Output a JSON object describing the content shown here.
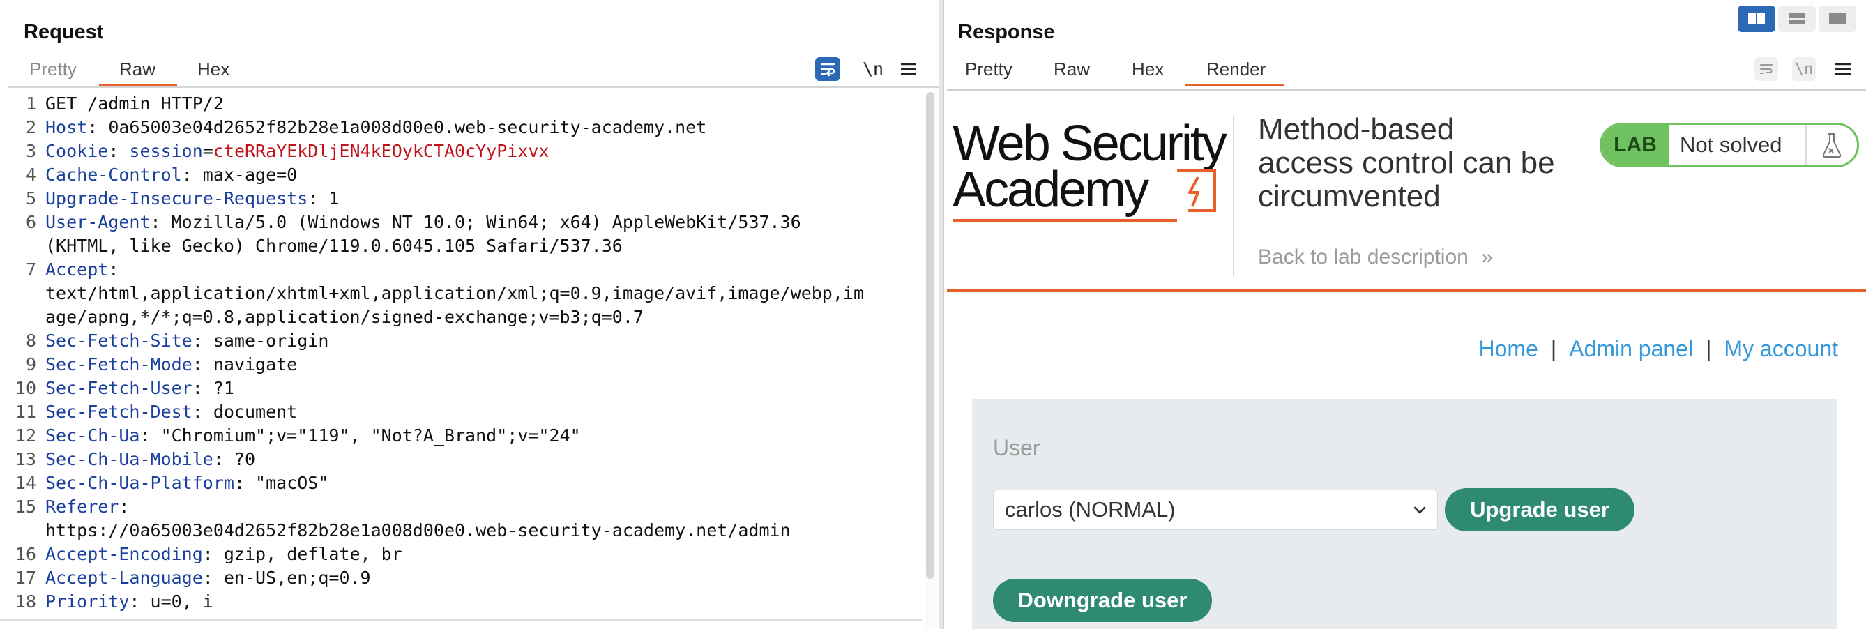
{
  "request": {
    "title": "Request",
    "tabs": [
      "Pretty",
      "Raw",
      "Hex"
    ],
    "active_tab": "Raw",
    "newline_toggle": "\\n",
    "lines": [
      {
        "n": "1",
        "parts": [
          {
            "t": "GET /admin HTTP/2",
            "c": "val"
          }
        ]
      },
      {
        "n": "2",
        "parts": [
          {
            "t": "Host",
            "c": "hdr"
          },
          {
            "t": ": 0a65003e04d2652f82b28e1a008d00e0.web-security-academy.net",
            "c": "val"
          }
        ]
      },
      {
        "n": "3",
        "parts": [
          {
            "t": "Cookie",
            "c": "hdr"
          },
          {
            "t": ": ",
            "c": "val"
          },
          {
            "t": "session",
            "c": "cookie-name"
          },
          {
            "t": "=",
            "c": "val"
          },
          {
            "t": "cteRRaYEkDljEN4kEOykCTA0cYyPixvx",
            "c": "cookie-val"
          }
        ]
      },
      {
        "n": "4",
        "parts": [
          {
            "t": "Cache-Control",
            "c": "hdr"
          },
          {
            "t": ": max-age=0",
            "c": "val"
          }
        ]
      },
      {
        "n": "5",
        "parts": [
          {
            "t": "Upgrade-Insecure-Requests",
            "c": "hdr"
          },
          {
            "t": ": 1",
            "c": "val"
          }
        ]
      },
      {
        "n": "6",
        "parts": [
          {
            "t": "User-Agent",
            "c": "hdr"
          },
          {
            "t": ": Mozilla/5.0 (Windows NT 10.0; Win64; x64) AppleWebKit/537.36",
            "c": "val"
          }
        ]
      },
      {
        "n": "",
        "parts": [
          {
            "t": "(KHTML, like Gecko) Chrome/119.0.6045.105 Safari/537.36",
            "c": "val"
          }
        ]
      },
      {
        "n": "7",
        "parts": [
          {
            "t": "Accept",
            "c": "hdr"
          },
          {
            "t": ":",
            "c": "val"
          }
        ]
      },
      {
        "n": "",
        "parts": [
          {
            "t": "text/html,application/xhtml+xml,application/xml;q=0.9,image/avif,image/webp,im",
            "c": "val"
          }
        ]
      },
      {
        "n": "",
        "parts": [
          {
            "t": "age/apng,*/*;q=0.8,application/signed-exchange;v=b3;q=0.7",
            "c": "val"
          }
        ]
      },
      {
        "n": "8",
        "parts": [
          {
            "t": "Sec-Fetch-Site",
            "c": "hdr"
          },
          {
            "t": ": same-origin",
            "c": "val"
          }
        ]
      },
      {
        "n": "9",
        "parts": [
          {
            "t": "Sec-Fetch-Mode",
            "c": "hdr"
          },
          {
            "t": ": navigate",
            "c": "val"
          }
        ]
      },
      {
        "n": "10",
        "parts": [
          {
            "t": "Sec-Fetch-User",
            "c": "hdr"
          },
          {
            "t": ": ?1",
            "c": "val"
          }
        ]
      },
      {
        "n": "11",
        "parts": [
          {
            "t": "Sec-Fetch-Dest",
            "c": "hdr"
          },
          {
            "t": ": document",
            "c": "val"
          }
        ]
      },
      {
        "n": "12",
        "parts": [
          {
            "t": "Sec-Ch-Ua",
            "c": "hdr"
          },
          {
            "t": ": \"Chromium\";v=\"119\", \"Not?A_Brand\";v=\"24\"",
            "c": "val"
          }
        ]
      },
      {
        "n": "13",
        "parts": [
          {
            "t": "Sec-Ch-Ua-Mobile",
            "c": "hdr"
          },
          {
            "t": ": ?0",
            "c": "val"
          }
        ]
      },
      {
        "n": "14",
        "parts": [
          {
            "t": "Sec-Ch-Ua-Platform",
            "c": "hdr"
          },
          {
            "t": ": \"macOS\"",
            "c": "val"
          }
        ]
      },
      {
        "n": "15",
        "parts": [
          {
            "t": "Referer",
            "c": "hdr"
          },
          {
            "t": ":",
            "c": "val"
          }
        ]
      },
      {
        "n": "",
        "parts": [
          {
            "t": "https://0a65003e04d2652f82b28e1a008d00e0.web-security-academy.net/admin",
            "c": "val"
          }
        ]
      },
      {
        "n": "16",
        "parts": [
          {
            "t": "Accept-Encoding",
            "c": "hdr"
          },
          {
            "t": ": gzip, deflate, br",
            "c": "val"
          }
        ]
      },
      {
        "n": "17",
        "parts": [
          {
            "t": "Accept-Language",
            "c": "hdr"
          },
          {
            "t": ": en-US,en;q=0.9",
            "c": "val"
          }
        ]
      },
      {
        "n": "18",
        "parts": [
          {
            "t": "Priority",
            "c": "hdr"
          },
          {
            "t": ": u=0, i",
            "c": "val"
          }
        ]
      }
    ]
  },
  "response": {
    "title": "Response",
    "tabs": [
      "Pretty",
      "Raw",
      "Hex",
      "Render"
    ],
    "active_tab": "Render",
    "newline_toggle": "\\n",
    "page": {
      "logo_line1": "Web Security",
      "logo_line2": "Academy",
      "lab_title": "Method-based access control can be circumvented",
      "back_link": "Back to lab description",
      "back_chevron": "»",
      "lab_badge": "LAB",
      "lab_status": "Not solved",
      "nav": {
        "home": "Home",
        "sep": "|",
        "admin": "Admin panel",
        "account": "My account"
      },
      "user_label": "User",
      "selected_user": "carlos (NORMAL)",
      "upgrade_button": "Upgrade user",
      "downgrade_button": "Downgrade user"
    }
  },
  "colors": {
    "accent_orange": "#e8602c",
    "tab_active_blue": "#2b69b4",
    "lab_green": "#70c160",
    "button_teal": "#2e8b72",
    "link_blue": "#3498db",
    "header_name_blue": "#1a3f9c",
    "cookie_red": "#c0141c"
  }
}
